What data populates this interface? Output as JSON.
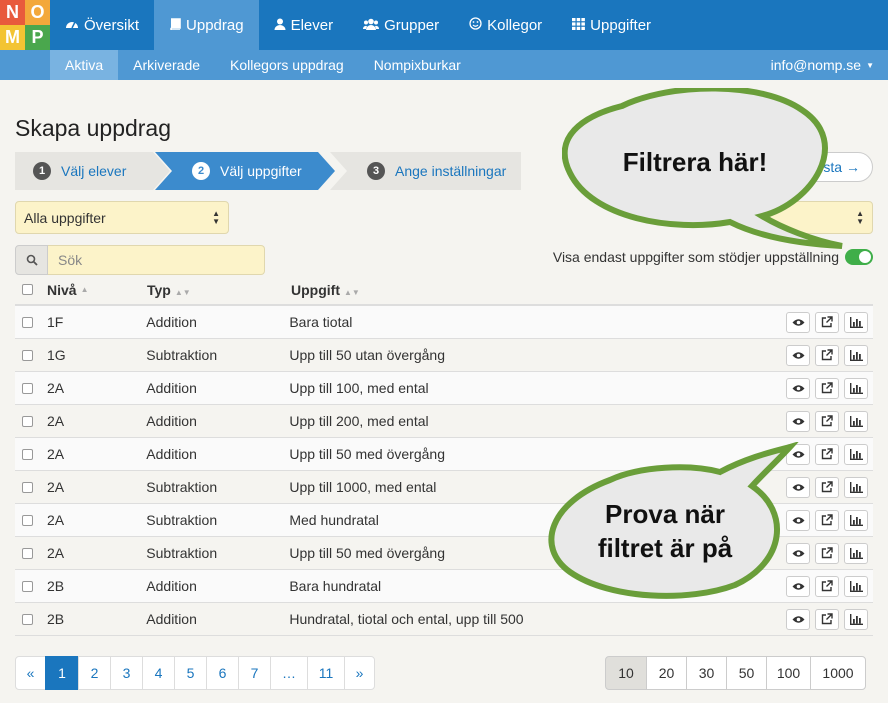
{
  "logo": {
    "letters": [
      "N",
      "O",
      "M",
      "P"
    ],
    "colors": [
      "#e85a3c",
      "#f3a83b",
      "#f3c433",
      "#4aa74d"
    ]
  },
  "nav": {
    "items": [
      {
        "label": "Översikt",
        "icon": "dashboard-icon"
      },
      {
        "label": "Uppdrag",
        "icon": "book-icon",
        "active": true
      },
      {
        "label": "Elever",
        "icon": "user-icon"
      },
      {
        "label": "Grupper",
        "icon": "users-icon"
      },
      {
        "label": "Kollegor",
        "icon": "smiley-icon"
      },
      {
        "label": "Uppgifter",
        "icon": "grid-icon"
      }
    ],
    "sub": [
      {
        "label": "Aktiva",
        "active": true
      },
      {
        "label": "Arkiverade"
      },
      {
        "label": "Kollegors uppdrag"
      },
      {
        "label": "Nompixburkar"
      }
    ],
    "user": "info@nomp.se"
  },
  "page": {
    "title": "Skapa uppdrag",
    "steps": [
      {
        "num": "1",
        "label": "Välj elever"
      },
      {
        "num": "2",
        "label": "Välj uppgifter"
      },
      {
        "num": "3",
        "label": "Ange inställningar"
      }
    ],
    "next_label": "sta →",
    "filter_select": "Alla uppgifter",
    "search_placeholder": "Sök",
    "toggle_label": "Visa endast uppgifter som stödjer uppställning"
  },
  "table": {
    "headers": {
      "level": "Nivå",
      "type": "Typ",
      "task": "Uppgift"
    },
    "rows": [
      {
        "level": "1F",
        "type": "Addition",
        "task": "Bara tiotal"
      },
      {
        "level": "1G",
        "type": "Subtraktion",
        "task": "Upp till 50 utan övergång"
      },
      {
        "level": "2A",
        "type": "Addition",
        "task": "Upp till 100, med ental"
      },
      {
        "level": "2A",
        "type": "Addition",
        "task": "Upp till 200, med ental"
      },
      {
        "level": "2A",
        "type": "Addition",
        "task": "Upp till 50 med övergång"
      },
      {
        "level": "2A",
        "type": "Subtraktion",
        "task": "Upp till 1000, med ental"
      },
      {
        "level": "2A",
        "type": "Subtraktion",
        "task": "Med hundratal"
      },
      {
        "level": "2A",
        "type": "Subtraktion",
        "task": "Upp till 50 med övergång"
      },
      {
        "level": "2B",
        "type": "Addition",
        "task": "Bara hundratal"
      },
      {
        "level": "2B",
        "type": "Addition",
        "task": "Hundratal, tiotal och ental, upp till 500"
      }
    ]
  },
  "pagination": {
    "pages": [
      "«",
      "1",
      "2",
      "3",
      "4",
      "5",
      "6",
      "7",
      "…",
      "11",
      "»"
    ],
    "active": "1",
    "sizes": [
      "10",
      "20",
      "30",
      "50",
      "100",
      "1000"
    ],
    "active_size": "10"
  },
  "callouts": {
    "top": "Filtrera här!",
    "bottom_line1": "Prova när",
    "bottom_line2": "filtret är på",
    "color": "#6a9e3a"
  }
}
